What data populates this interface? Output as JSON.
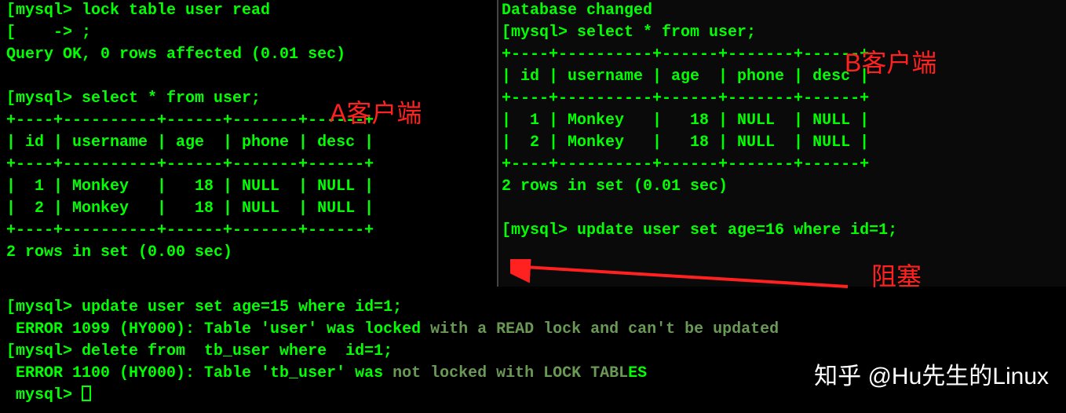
{
  "left": {
    "l1_prompt": "[mysql>",
    "l1_cmd": " lock table user read",
    "l2_prompt": "[    ->",
    "l2_cmd": " ;",
    "l3": "Query OK, 0 rows affected (0.01 sec)",
    "l5_prompt": "[mysql>",
    "l5_cmd": " select * from user;",
    "table_border": "+----+----------+------+-------+------+",
    "table_header": "| id | username | age  | phone | desc |",
    "row1": "|  1 | Monkey   |   18 | NULL  | NULL |",
    "row2": "|  2 | Monkey   |   18 | NULL  | NULL |",
    "summary": "2 rows in set (0.00 sec)"
  },
  "right": {
    "l1": "Database changed",
    "l2_prompt": "[mysql>",
    "l2_cmd": " select * from user;",
    "table_border": "+----+----------+------+-------+------+",
    "table_header": "| id | username | age  | phone | desc |",
    "row1": "|  1 | Monkey   |   18 | NULL  | NULL |",
    "row2": "|  2 | Monkey   |   18 | NULL  | NULL |",
    "summary": "2 rows in set (0.01 sec)",
    "l_update_prompt": "[mysql>",
    "l_update_cmd": " update user set age=16 where id=1;"
  },
  "bottom": {
    "l1_prompt": "[mysql>",
    "l1_cmd": " update user set age=15 where id=1;",
    "l2_bright": " ERROR 1099 (HY000): Table 'user' was locked",
    "l2_dim": " with a READ lock and can't be updated",
    "l3_prompt": "[mysql>",
    "l3_cmd": " delete from  tb_user where  id=1;",
    "l4_bright_a": " ERROR 1100 (HY000): Table 'tb_user' was",
    "l4_dim": " not locked with LOCK TABL",
    "l4_bright_b": "ES",
    "l5_prompt": " mysql>"
  },
  "labels": {
    "a": "A客户端",
    "b": "B客户端",
    "block": "阻塞"
  },
  "watermark": "知乎 @Hu先生的Linux"
}
